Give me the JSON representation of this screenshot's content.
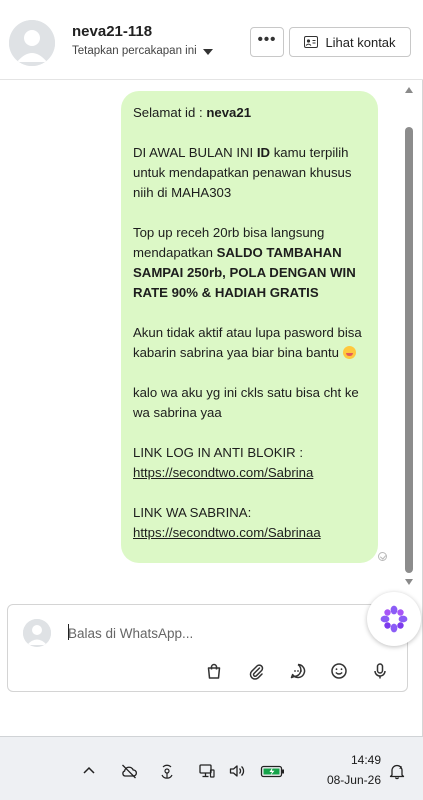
{
  "header": {
    "contact_name": "neva21-118",
    "pin_label": "Tetapkan percakapan ini",
    "more_label": "•••",
    "view_contact_label": "Lihat kontak"
  },
  "message": {
    "greet_prefix": "Selamat id : ",
    "greet_name": "neva21",
    "p2_a": "DI AWAL BULAN INI ",
    "p2_b": "ID",
    "p2_c": " kamu terpilih untuk mendapatkan penawan khusus niih di MAHA303",
    "p3_a": "Top up receh 20rb bisa langsung mendapatkan ",
    "p3_b": "SALDO TAMBAHAN SAMPAI 250rb, POLA DENGAN WIN RATE 90% & HADIAH GRATIS",
    "p4": "Akun tidak aktif atau lupa pasword bisa kabarin sabrina yaa biar bina bantu ",
    "p5": "kalo wa aku yg ini ckls satu bisa cht ke wa sabrina yaa",
    "link1_label": "LINK LOG IN ANTI BLOKIR :",
    "link1_url": "https://secondtwo.com/Sabrina",
    "link2_label": "LINK WA SABRINA:",
    "link2_url": "https://secondtwo.com/Sabrinaa"
  },
  "reply": {
    "placeholder": "Balas di WhatsApp..."
  },
  "taskbar": {
    "time": "14:49",
    "date": "08-Jun-26"
  },
  "colors": {
    "bubble": "#dcf8c6",
    "ai_accent": "#8b5cf6"
  }
}
